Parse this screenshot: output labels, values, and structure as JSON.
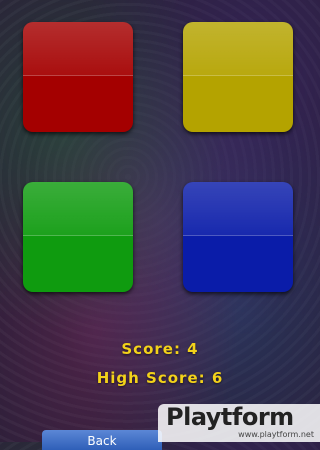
{
  "game": {
    "pads": [
      {
        "color_name": "red",
        "color": "#a40000"
      },
      {
        "color_name": "yellow",
        "color": "#b4a300"
      },
      {
        "color_name": "green",
        "color": "#0f9b0f"
      },
      {
        "color_name": "blue",
        "color": "#0a1ca9"
      }
    ],
    "score_text": "Score: 4",
    "high_score_text": "High Score: 6",
    "score_text_color": "#f3d21a"
  },
  "bottom_button": {
    "label": "Back"
  },
  "watermark": {
    "logo": "Playtform",
    "url": "www.playtform.net"
  }
}
